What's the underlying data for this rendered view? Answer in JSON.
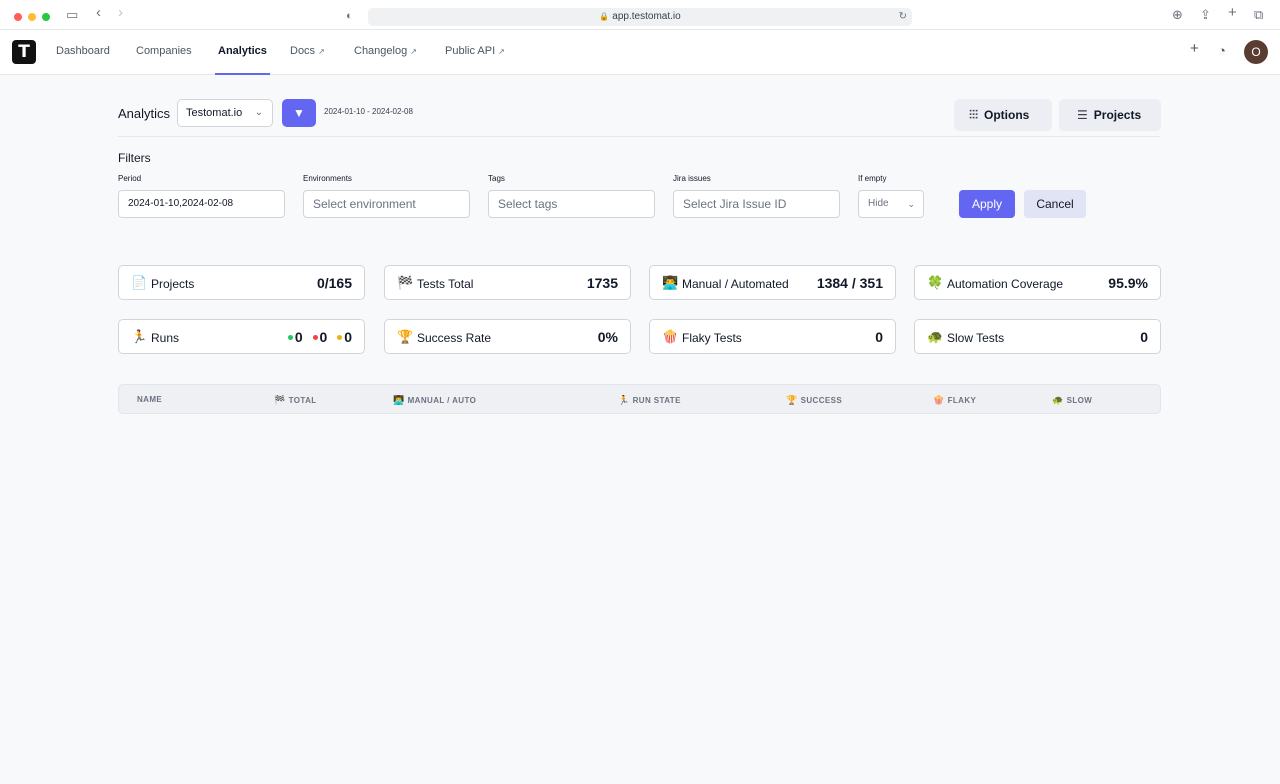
{
  "browser": {
    "url": "app.testomat.io",
    "traffic_colors": [
      "#ff5f57",
      "#febc2e",
      "#28c840"
    ]
  },
  "nav": {
    "logo": "T",
    "items": [
      {
        "label": "Dashboard",
        "active": false,
        "external": false
      },
      {
        "label": "Companies",
        "active": false,
        "external": false
      },
      {
        "label": "Analytics",
        "active": true,
        "external": false
      },
      {
        "label": "Docs",
        "active": false,
        "external": true
      },
      {
        "label": "Changelog",
        "active": false,
        "external": true
      },
      {
        "label": "Public API",
        "active": false,
        "external": true
      }
    ],
    "avatar_initial": "O"
  },
  "header": {
    "title": "Analytics",
    "project": "Testomat.io",
    "date_range": "2024-01-10 - 2024-02-08",
    "options_label": "Options",
    "projects_label": "Projects"
  },
  "filters": {
    "title": "Filters",
    "period": {
      "label": "Period",
      "value": "2024-01-10,2024-02-08"
    },
    "environments": {
      "label": "Environments",
      "placeholder": "Select environment"
    },
    "tags": {
      "label": "Tags",
      "placeholder": "Select tags"
    },
    "jira": {
      "label": "Jira issues",
      "placeholder": "Select Jira Issue ID"
    },
    "if_empty": {
      "label": "If empty",
      "value": "Hide"
    },
    "apply_label": "Apply",
    "cancel_label": "Cancel"
  },
  "stats": {
    "projects": {
      "icon": "📄",
      "label": "Projects",
      "value": "0/165"
    },
    "tests_total": {
      "icon": "🏁",
      "label": "Tests Total",
      "value": "1735"
    },
    "manual_automated": {
      "icon": "👨‍💻",
      "label": "Manual / Automated",
      "value": "1384 / 351"
    },
    "automation_coverage": {
      "icon": "🍀",
      "label": "Automation Coverage",
      "value": "95.9%"
    },
    "runs": {
      "icon": "🏃",
      "label": "Runs",
      "passed": "0",
      "failed": "0",
      "pending": "0",
      "colors": [
        "#22c55e",
        "#ef4444",
        "#eab308"
      ]
    },
    "success_rate": {
      "icon": "🏆",
      "label": "Success Rate",
      "value": "0%"
    },
    "flaky_tests": {
      "icon": "🍿",
      "label": "Flaky Tests",
      "value": "0"
    },
    "slow_tests": {
      "icon": "🐢",
      "label": "Slow Tests",
      "value": "0"
    }
  },
  "table": {
    "columns": [
      {
        "icon": "",
        "label": "NAME"
      },
      {
        "icon": "🏁",
        "label": "TOTAL"
      },
      {
        "icon": "👨‍💻",
        "label": "MANUAL / AUTO"
      },
      {
        "icon": "🏃",
        "label": "RUN STATE"
      },
      {
        "icon": "🏆",
        "label": "SUCCESS"
      },
      {
        "icon": "🍿",
        "label": "FLAKY"
      },
      {
        "icon": "🐢",
        "label": "SLOW"
      }
    ]
  },
  "colors": {
    "accent": "#6366f1",
    "cancel_bg": "#e0e4f5",
    "avatar": "#5a3d31"
  }
}
